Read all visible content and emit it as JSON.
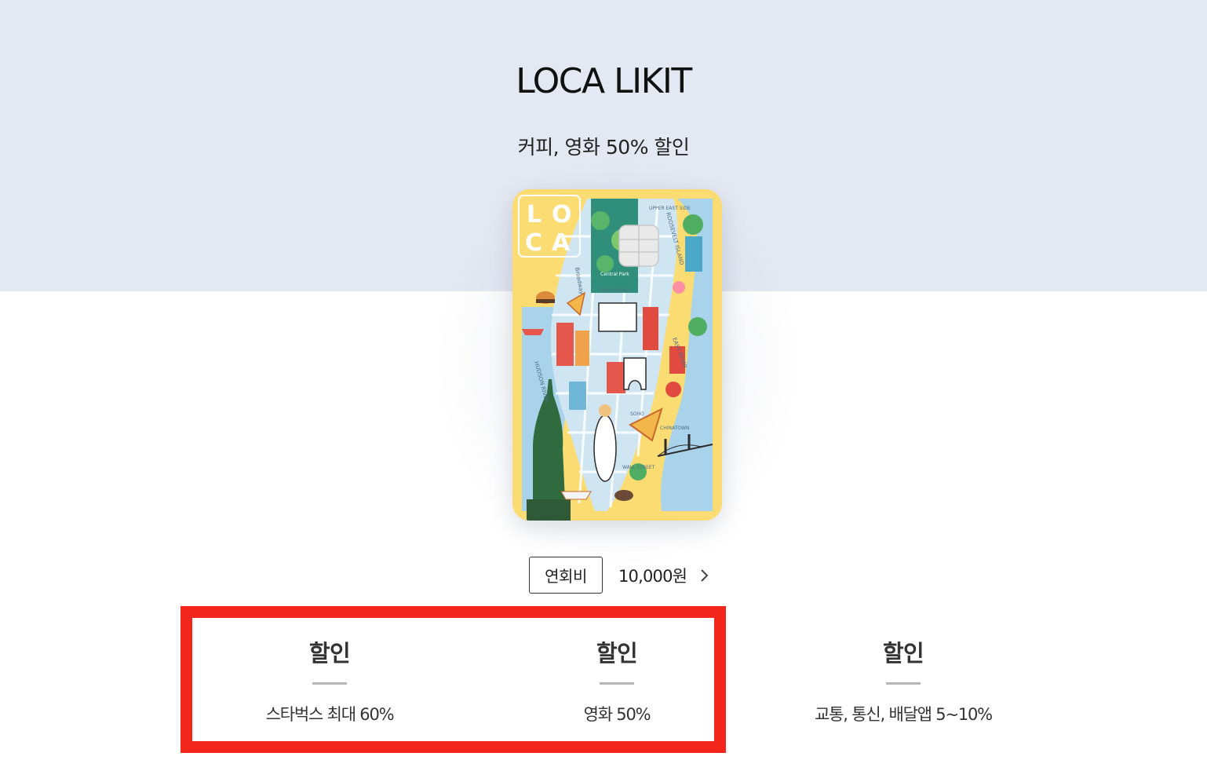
{
  "hero": {
    "title": "LOCA LIKIT",
    "subtitle": "커피, 영화 50% 할인",
    "background": "#e4e8f2"
  },
  "card": {
    "name": "LOCA",
    "color": "#fbdc73",
    "map_labels": {
      "central_park": "Central Park",
      "times_square": "Times Square",
      "upper_east_side": "UPPER EAST SIDE",
      "roosevelt_island": "ROOSEVELT ISLAND",
      "east_river": "EAST RIVER",
      "hudson_river": "HUDSON RIVER",
      "soho": "SOHO",
      "chinatown": "CHINATOWN",
      "wall_street": "WALL STREET",
      "broadway": "Broadway"
    }
  },
  "fee": {
    "label": "연회비",
    "value": "10,000원",
    "chevron_icon": "chevron-right-icon"
  },
  "highlight_color": "#f4261c",
  "benefits": [
    {
      "title": "할인",
      "desc": "스타벅스 최대 60%"
    },
    {
      "title": "할인",
      "desc": "영화 50%"
    },
    {
      "title": "할인",
      "desc": "교통, 통신, 배달앱 5~10%"
    }
  ]
}
